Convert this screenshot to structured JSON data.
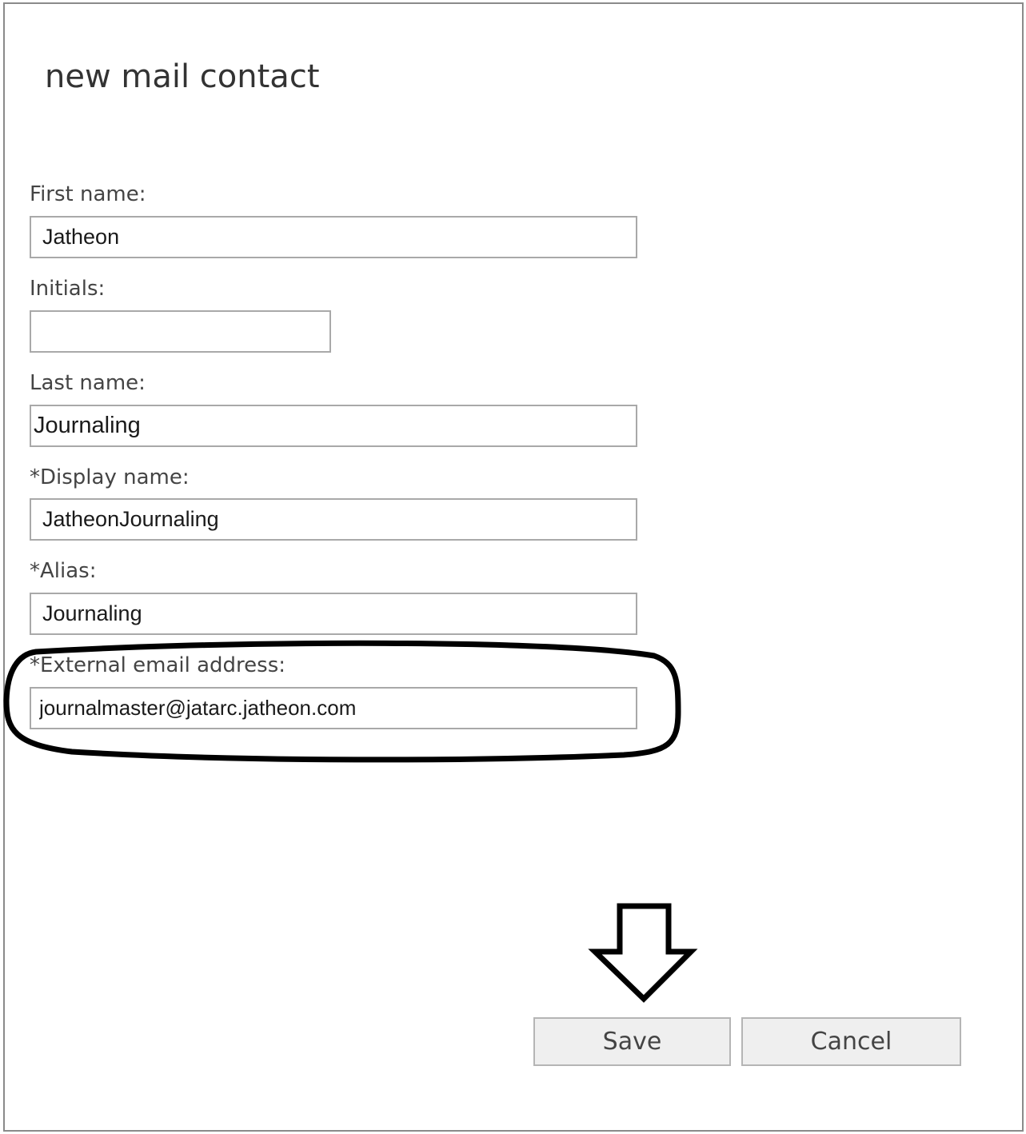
{
  "dialog": {
    "title": "new mail contact"
  },
  "form": {
    "first_name": {
      "label": "First name:",
      "value": "Jatheon"
    },
    "initials": {
      "label": "Initials:",
      "value": ""
    },
    "last_name": {
      "label": "Last name:",
      "value": "Journaling"
    },
    "display_name": {
      "label": "*Display name:",
      "value": "JatheonJournaling"
    },
    "alias": {
      "label": "*Alias:",
      "value": "Journaling"
    },
    "external_email": {
      "label": "*External email address:",
      "value": "journalmaster@jatarc.jatheon.com"
    }
  },
  "buttons": {
    "save_label": "Save",
    "cancel_label": "Cancel"
  },
  "annotations": {
    "highlight_icon": "ellipse-highlight",
    "arrow_icon": "down-arrow",
    "annotation_color": "#000000"
  }
}
